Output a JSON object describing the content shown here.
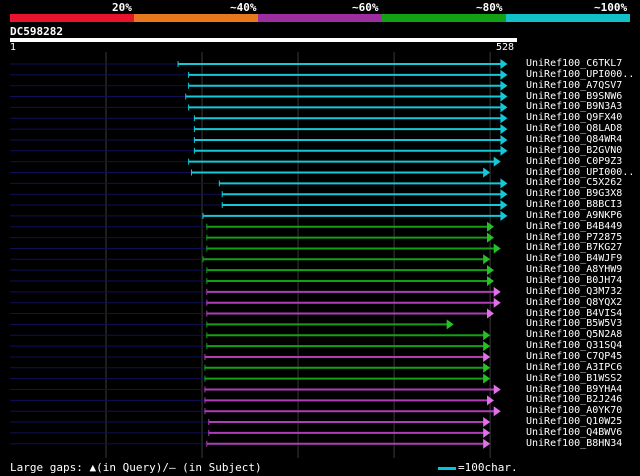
{
  "legend": {
    "labels": [
      "20%",
      "~40%",
      "~60%",
      "~80%",
      "~100%"
    ],
    "colors": [
      "#e8142e",
      "#e8781e",
      "#9c2ea0",
      "#14a014",
      "#14c0c8"
    ]
  },
  "query": {
    "name": "DC598282",
    "start": "1",
    "end": "528",
    "length": 528
  },
  "colors": {
    "cyan": "#14c8d8",
    "green": "#14a014",
    "purple": "#b03cb8",
    "cyan_head": "#14c8d8",
    "green_head": "#28c028",
    "purple_head": "#e070e8",
    "dim_line": "#10105a"
  },
  "hits": [
    {
      "name": "UniRef100_C6TKL7",
      "start": 175,
      "end": 517,
      "color": "cyan"
    },
    {
      "name": "UniRef100_UPI000..",
      "start": 186,
      "end": 517,
      "color": "cyan"
    },
    {
      "name": "UniRef100_A7QSV7",
      "start": 186,
      "end": 517,
      "color": "cyan"
    },
    {
      "name": "UniRef100_B9SNW6",
      "start": 183,
      "end": 517,
      "color": "cyan"
    },
    {
      "name": "UniRef100_B9N3A3",
      "start": 186,
      "end": 517,
      "color": "cyan"
    },
    {
      "name": "UniRef100_Q9FX40",
      "start": 192,
      "end": 517,
      "color": "cyan"
    },
    {
      "name": "UniRef100_Q8LAD8",
      "start": 192,
      "end": 517,
      "color": "cyan"
    },
    {
      "name": "UniRef100_Q84WR4",
      "start": 192,
      "end": 517,
      "color": "cyan"
    },
    {
      "name": "UniRef100_B2GVN0",
      "start": 192,
      "end": 517,
      "color": "cyan"
    },
    {
      "name": "UniRef100_C0P9Z3",
      "start": 186,
      "end": 510,
      "color": "cyan"
    },
    {
      "name": "UniRef100_UPI000..",
      "start": 189,
      "end": 499,
      "color": "cyan"
    },
    {
      "name": "UniRef100_C5X262",
      "start": 218,
      "end": 517,
      "color": "cyan"
    },
    {
      "name": "UniRef100_B9G3X8",
      "start": 221,
      "end": 517,
      "color": "cyan"
    },
    {
      "name": "UniRef100_B8BCI3",
      "start": 221,
      "end": 517,
      "color": "cyan"
    },
    {
      "name": "UniRef100_A9NKP6",
      "start": 201,
      "end": 517,
      "color": "cyan"
    },
    {
      "name": "UniRef100_B4B449",
      "start": 205,
      "end": 503,
      "color": "green"
    },
    {
      "name": "UniRef100_P72875",
      "start": 205,
      "end": 503,
      "color": "green"
    },
    {
      "name": "UniRef100_B7KG27",
      "start": 205,
      "end": 510,
      "color": "green"
    },
    {
      "name": "UniRef100_B4WJF9",
      "start": 201,
      "end": 499,
      "color": "green"
    },
    {
      "name": "UniRef100_A8YHW9",
      "start": 205,
      "end": 503,
      "color": "green"
    },
    {
      "name": "UniRef100_B0JH74",
      "start": 205,
      "end": 503,
      "color": "green"
    },
    {
      "name": "UniRef100_Q3M732",
      "start": 205,
      "end": 510,
      "color": "purple"
    },
    {
      "name": "UniRef100_Q8YQX2",
      "start": 205,
      "end": 510,
      "color": "purple"
    },
    {
      "name": "UniRef100_B4VIS4",
      "start": 205,
      "end": 503,
      "color": "purple"
    },
    {
      "name": "UniRef100_B5W5V3",
      "start": 205,
      "end": 461,
      "color": "green"
    },
    {
      "name": "UniRef100_Q5N2A8",
      "start": 205,
      "end": 499,
      "color": "green"
    },
    {
      "name": "UniRef100_Q31SQ4",
      "start": 205,
      "end": 499,
      "color": "green"
    },
    {
      "name": "UniRef100_C7QP45",
      "start": 203,
      "end": 499,
      "color": "purple"
    },
    {
      "name": "UniRef100_A3IPC6",
      "start": 203,
      "end": 499,
      "color": "green"
    },
    {
      "name": "UniRef100_B1WSS2",
      "start": 203,
      "end": 499,
      "color": "green"
    },
    {
      "name": "UniRef100_B9YHA4",
      "start": 203,
      "end": 510,
      "color": "purple"
    },
    {
      "name": "UniRef100_B2J246",
      "start": 203,
      "end": 503,
      "color": "purple"
    },
    {
      "name": "UniRef100_A0YK70",
      "start": 203,
      "end": 510,
      "color": "purple"
    },
    {
      "name": "UniRef100_Q10W25",
      "start": 207,
      "end": 499,
      "color": "purple"
    },
    {
      "name": "UniRef100_Q4BWV6",
      "start": 207,
      "end": 499,
      "color": "purple"
    },
    {
      "name": "UniRef100_B8HN34",
      "start": 205,
      "end": 499,
      "color": "purple"
    }
  ],
  "footer": {
    "gaps_text": "Large gaps: ▲(in Query)/– (in Subject)",
    "scale_text": "=100char."
  }
}
